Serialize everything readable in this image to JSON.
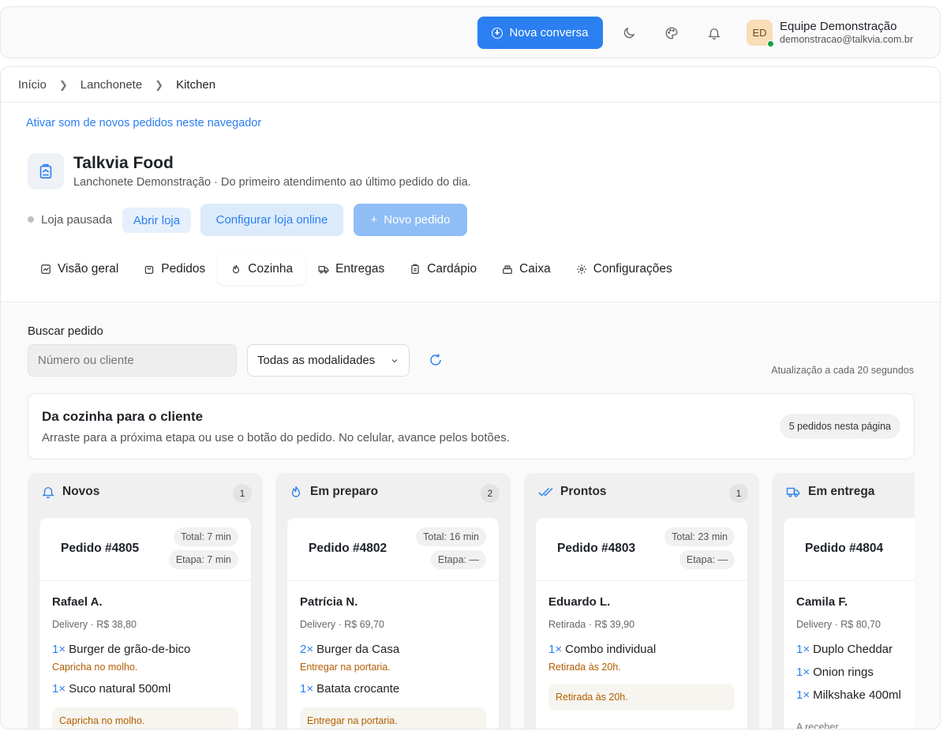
{
  "header": {
    "new_conversation": "Nova conversa",
    "user_initials": "ED",
    "user_name": "Equipe Demonstração",
    "user_email": "demonstracao@talkvia.com.br"
  },
  "breadcrumb": [
    "Início",
    "Lanchonete",
    "Kitchen"
  ],
  "sound_link": "Ativar som de novos pedidos neste navegador",
  "store": {
    "name": "Talkvia Food",
    "subtitle": "Lanchonete Demonstração · Do primeiro atendimento ao último pedido do dia.",
    "status": "Loja pausada",
    "open_button": "Abrir loja",
    "config_button": "Configurar loja online",
    "new_order_button": "Novo pedido"
  },
  "tabs": [
    {
      "label": "Visão geral",
      "icon": "chart-icon"
    },
    {
      "label": "Pedidos",
      "icon": "bag-icon"
    },
    {
      "label": "Cozinha",
      "icon": "flame-icon"
    },
    {
      "label": "Entregas",
      "icon": "truck-icon"
    },
    {
      "label": "Cardápio",
      "icon": "menu-book-icon"
    },
    {
      "label": "Caixa",
      "icon": "register-icon"
    },
    {
      "label": "Configurações",
      "icon": "gear-icon"
    }
  ],
  "active_tab": "Cozinha",
  "filters": {
    "search_label": "Buscar pedido",
    "search_placeholder": "Número ou cliente",
    "modality": "Todas as modalidades",
    "update_note": "Atualização a cada 20 segundos"
  },
  "info": {
    "title": "Da cozinha para o cliente",
    "subtitle": "Arraste para a próxima etapa ou use o botão do pedido. No celular, avance pelos botões.",
    "badge": "5 pedidos nesta página"
  },
  "columns": [
    {
      "title": "Novos",
      "count": "1",
      "icon": "bell-icon",
      "order": {
        "id": "Pedido #4805",
        "total": "Total: 7 min",
        "stage": "Etapa: 7 min",
        "customer": "Rafael A.",
        "meta": "Delivery · R$ 38,80",
        "items": [
          {
            "qty": "1×",
            "name": "Burger de grão-de-bico",
            "note": "Capricha no molho."
          },
          {
            "qty": "1×",
            "name": "Suco natural 500ml",
            "note": ""
          }
        ],
        "note_box": "Capricha no molho."
      }
    },
    {
      "title": "Em preparo",
      "count": "2",
      "icon": "flame-icon",
      "order": {
        "id": "Pedido #4802",
        "total": "Total: 16 min",
        "stage": "Etapa: —",
        "customer": "Patrícia N.",
        "meta": "Delivery · R$ 69,70",
        "items": [
          {
            "qty": "2×",
            "name": "Burger da Casa",
            "note": "Entregar na portaria."
          },
          {
            "qty": "1×",
            "name": "Batata crocante",
            "note": ""
          }
        ],
        "note_box": "Entregar na portaria."
      }
    },
    {
      "title": "Prontos",
      "count": "1",
      "icon": "double-check-icon",
      "order": {
        "id": "Pedido #4803",
        "total": "Total: 23 min",
        "stage": "Etapa: —",
        "customer": "Eduardo L.",
        "meta": "Retirada · R$ 39,90",
        "items": [
          {
            "qty": "1×",
            "name": "Combo individual",
            "note": "Retirada às 20h."
          }
        ],
        "note_box": "Retirada às 20h."
      }
    },
    {
      "title": "Em entrega",
      "count": "",
      "icon": "truck-icon",
      "order": {
        "id": "Pedido #4804",
        "customer": "Camila F.",
        "meta": "Delivery · R$ 80,70",
        "items": [
          {
            "qty": "1×",
            "name": "Duplo Cheddar"
          },
          {
            "qty": "1×",
            "name": "Onion rings"
          },
          {
            "qty": "1×",
            "name": "Milkshake 400ml"
          }
        ],
        "footer": "A receber"
      }
    }
  ]
}
